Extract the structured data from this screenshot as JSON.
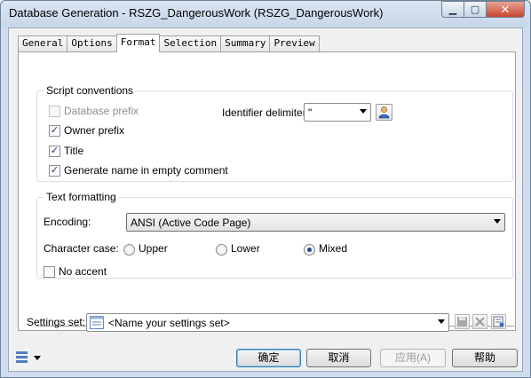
{
  "window": {
    "title": "Database Generation - RSZG_DangerousWork (RSZG_DangerousWork)",
    "min_glyph": "▁",
    "max_glyph": "▢",
    "close_glyph": "✕"
  },
  "tabs": [
    {
      "label": "General"
    },
    {
      "label": "Options"
    },
    {
      "label": "Format",
      "active": true
    },
    {
      "label": "Selection"
    },
    {
      "label": "Summary"
    },
    {
      "label": "Preview"
    }
  ],
  "script_conventions": {
    "legend": "Script conventions",
    "database_prefix": {
      "label": "Database prefix",
      "checked": false,
      "enabled": false
    },
    "owner_prefix": {
      "label": "Owner prefix",
      "checked": true
    },
    "title": {
      "label": "Title",
      "checked": true
    },
    "generate_name": {
      "label": "Generate name in empty comment",
      "checked": true
    },
    "identifier_delimiter": {
      "label": "Identifier delimiter:",
      "value": "\""
    }
  },
  "text_formatting": {
    "legend": "Text formatting",
    "encoding": {
      "label": "Encoding:",
      "value": "ANSI (Active Code Page)"
    },
    "character_case": {
      "label": "Character case:",
      "options": [
        {
          "label": "Upper",
          "selected": false
        },
        {
          "label": "Lower",
          "selected": false
        },
        {
          "label": "Mixed",
          "selected": true
        }
      ]
    },
    "no_accent": {
      "label": "No accent",
      "checked": false
    }
  },
  "settings": {
    "label": "Settings set:",
    "value": "<Name your settings set>"
  },
  "buttons": {
    "ok": "确定",
    "cancel": "取消",
    "apply": "应用(A)",
    "help": "帮助"
  },
  "check_glyph": "✓"
}
